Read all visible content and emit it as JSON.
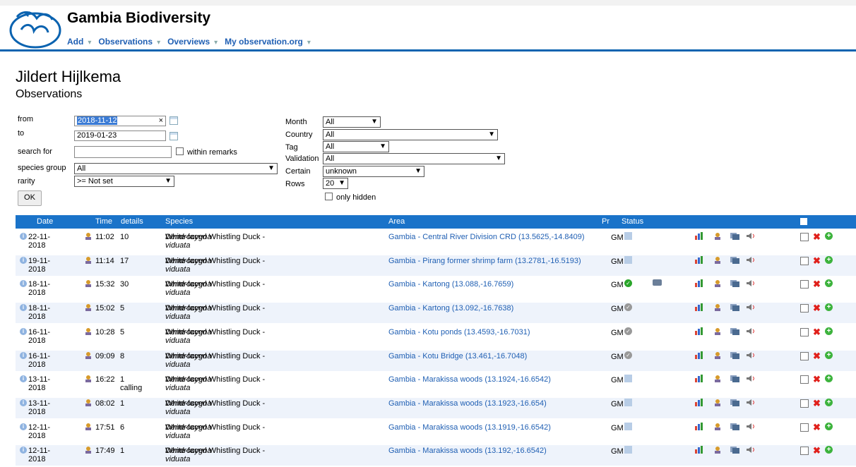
{
  "site_title": "Gambia Biodiversity",
  "nav": [
    "Add",
    "Observations",
    "Overviews",
    "My observation.org"
  ],
  "user_name": "Jildert Hijlkema",
  "page_subtitle": "Observations",
  "filters": {
    "from_label": "from",
    "from_value": "2018-11-12",
    "to_label": "to",
    "to_value": "2019-01-23",
    "search_label": "search for",
    "within_remarks_label": "within remarks",
    "species_group_label": "species group",
    "species_group_value": "All",
    "rarity_label": "rarity",
    "rarity_value": ">= Not set",
    "ok_label": "OK",
    "month_label": "Month",
    "month_value": "All",
    "country_label": "Country",
    "country_value": "All",
    "tag_label": "Tag",
    "tag_value": "All",
    "validation_label": "Validation",
    "validation_value": "All",
    "certain_label": "Certain",
    "certain_value": "unknown",
    "rows_label": "Rows",
    "rows_value": "20",
    "only_hidden_label": "only hidden"
  },
  "table_headers": {
    "date": "Date",
    "time": "Time",
    "details": "details",
    "species": "Species",
    "area": "Area",
    "pr": "Pr",
    "status": "Status"
  },
  "rows": [
    {
      "date": "22-11-2018",
      "time": "11:02",
      "details": "10",
      "species_common": "White-faced Whistling Duck - ",
      "species_latin_a": "Dendrocygna",
      "species_latin_b": "viduata",
      "area": "Gambia - Central River Division CRD (13.5625,-14.8409)",
      "pr": "GM",
      "status": "pending"
    },
    {
      "date": "19-11-2018",
      "time": "11:14",
      "details": "17",
      "species_common": "White-faced Whistling Duck - ",
      "species_latin_a": "Dendrocygna",
      "species_latin_b": "viduata",
      "area": "Gambia - Pirang former shrimp farm (13.2781,-16.5193)",
      "pr": "GM",
      "status": "pending"
    },
    {
      "date": "18-11-2018",
      "time": "15:32",
      "details": "30",
      "species_common": "White-faced Whistling Duck - ",
      "species_latin_a": "Dendrocygna",
      "species_latin_b": "viduata",
      "area": "Gambia - Kartong (13.088,-16.7659)",
      "pr": "GM",
      "status": "approved",
      "photo": true
    },
    {
      "date": "18-11-2018",
      "time": "15:02",
      "details": "5",
      "species_common": "White-faced Whistling Duck - ",
      "species_latin_a": "Dendrocygna",
      "species_latin_b": "viduata",
      "area": "Gambia - Kartong (13.092,-16.7638)",
      "pr": "GM",
      "status": "assumed"
    },
    {
      "date": "16-11-2018",
      "time": "10:28",
      "details": "5",
      "species_common": "White-faced Whistling Duck - ",
      "species_latin_a": "Dendrocygna",
      "species_latin_b": "viduata",
      "area": "Gambia - Kotu ponds (13.4593,-16.7031)",
      "pr": "GM",
      "status": "assumed"
    },
    {
      "date": "16-11-2018",
      "time": "09:09",
      "details": "8",
      "species_common": "White-faced Whistling Duck - ",
      "species_latin_a": "Dendrocygna",
      "species_latin_b": "viduata",
      "area": "Gambia - Kotu Bridge (13.461,-16.7048)",
      "pr": "GM",
      "status": "assumed"
    },
    {
      "date": "13-11-2018",
      "time": "16:22",
      "details": "1 calling",
      "species_common": "White-faced Whistling Duck - ",
      "species_latin_a": "Dendrocygna",
      "species_latin_b": "viduata",
      "area": "Gambia - Marakissa woods (13.1924,-16.6542)",
      "pr": "GM",
      "status": "pending"
    },
    {
      "date": "13-11-2018",
      "time": "08:02",
      "details": "1",
      "species_common": "White-faced Whistling Duck - ",
      "species_latin_a": "Dendrocygna",
      "species_latin_b": "viduata",
      "area": "Gambia - Marakissa woods (13.1923,-16.654)",
      "pr": "GM",
      "status": "pending"
    },
    {
      "date": "12-11-2018",
      "time": "17:51",
      "details": "6",
      "species_common": "White-faced Whistling Duck - ",
      "species_latin_a": "Dendrocygna",
      "species_latin_b": "viduata",
      "area": "Gambia - Marakissa woods (13.1919,-16.6542)",
      "pr": "GM",
      "status": "pending"
    },
    {
      "date": "12-11-2018",
      "time": "17:49",
      "details": "1",
      "species_common": "White-faced Whistling Duck - ",
      "species_latin_a": "Dendrocygna",
      "species_latin_b": "viduata",
      "area": "Gambia - Marakissa woods (13.192,-16.6542)",
      "pr": "GM",
      "status": "pending"
    }
  ]
}
